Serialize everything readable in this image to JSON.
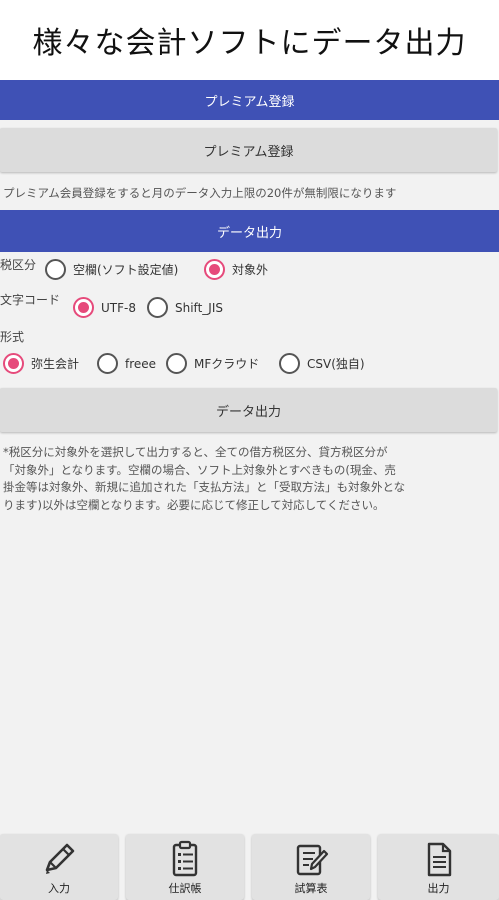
{
  "app_title": "様々な会計ソフトにデータ出力",
  "premium": {
    "section_title": "プレミアム登録",
    "button_label": "プレミアム登録",
    "description": "プレミアム会員登録をすると月のデータ入力上限の20件が無制限になります"
  },
  "export": {
    "section_title": "データ出力",
    "tax": {
      "label": "税区分",
      "options": [
        "空欄(ソフト設定値)",
        "対象外"
      ],
      "selected": "対象外"
    },
    "charset": {
      "label": "文字コード",
      "options": [
        "UTF-8",
        "Shift_JIS"
      ],
      "selected": "UTF-8"
    },
    "format": {
      "label": "形式",
      "options": [
        "弥生会計",
        "freee",
        "MFクラウド",
        "CSV(独自)"
      ],
      "selected": "弥生会計"
    },
    "button_label": "データ出力",
    "notice_lines": [
      "*税区分に対象外を選択して出力すると、全ての借方税区分、貸方税区分が",
      "「対象外」となります。空欄の場合、ソフト上対象外とすべきもの(現金、売",
      "掛金等は対象外、新規に追加された「支払方法」と「受取方法」も対象外とな",
      "ります)以外は空欄となります。必要に応じて修正して対応してください。"
    ]
  },
  "bottom_nav": [
    {
      "label": "入力",
      "icon": "pencil-icon"
    },
    {
      "label": "仕訳帳",
      "icon": "clipboard-list-icon"
    },
    {
      "label": "試算表",
      "icon": "ledger-edit-icon"
    },
    {
      "label": "出力",
      "icon": "document-icon"
    }
  ],
  "colors": {
    "accent_bar": "#3f51b5",
    "radio_checked": "#e64a7b"
  }
}
